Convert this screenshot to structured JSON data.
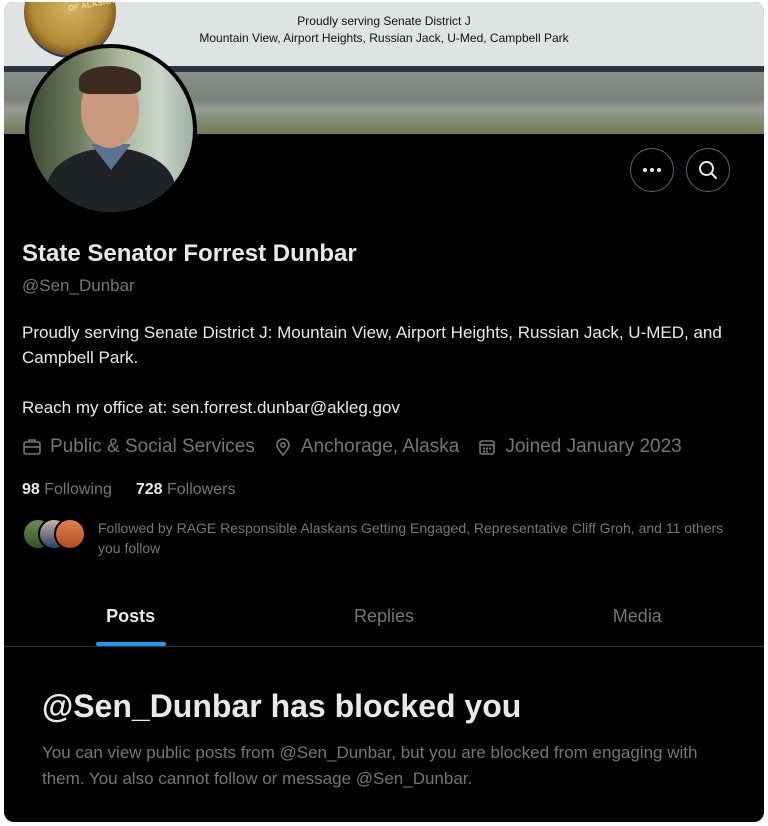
{
  "banner": {
    "line1": "Proudly serving Senate District J",
    "line2": "Mountain View, Airport Heights, Russian Jack, U-Med, Campbell Park",
    "seal_text": "OF ALASKA"
  },
  "profile": {
    "name": "State Senator Forrest Dunbar",
    "handle": "@Sen_Dunbar",
    "bio": "Proudly serving Senate District J: Mountain View, Airport Heights, Russian Jack, U-MED, and Campbell Park.\n\nReach my office at: sen.forrest.dunbar@akleg.gov",
    "category": "Public & Social Services",
    "location": "Anchorage, Alaska",
    "joined": "Joined January 2023",
    "following_count": "98",
    "following_label": "Following",
    "followers_count": "728",
    "followers_label": "Followers",
    "followed_by": "Followed by RAGE Responsible Alaskans Getting Engaged, Representative Cliff Groh, and 11 others you follow"
  },
  "icons": {
    "more": "more-icon",
    "search": "search-icon",
    "category": "briefcase-icon",
    "location": "location-pin-icon",
    "joined": "calendar-icon"
  },
  "tabs": [
    {
      "label": "Posts",
      "active": true
    },
    {
      "label": "Replies",
      "active": false
    },
    {
      "label": "Media",
      "active": false
    }
  ],
  "blocked": {
    "title": "@Sen_Dunbar has blocked you",
    "text": "You can view public posts from @Sen_Dunbar, but you are blocked from engaging with them. You also cannot follow or message @Sen_Dunbar."
  },
  "colors": {
    "background": "#000000",
    "primary_text": "#e7e9ea",
    "secondary_text": "#71767b",
    "accent": "#1d9bf0"
  }
}
